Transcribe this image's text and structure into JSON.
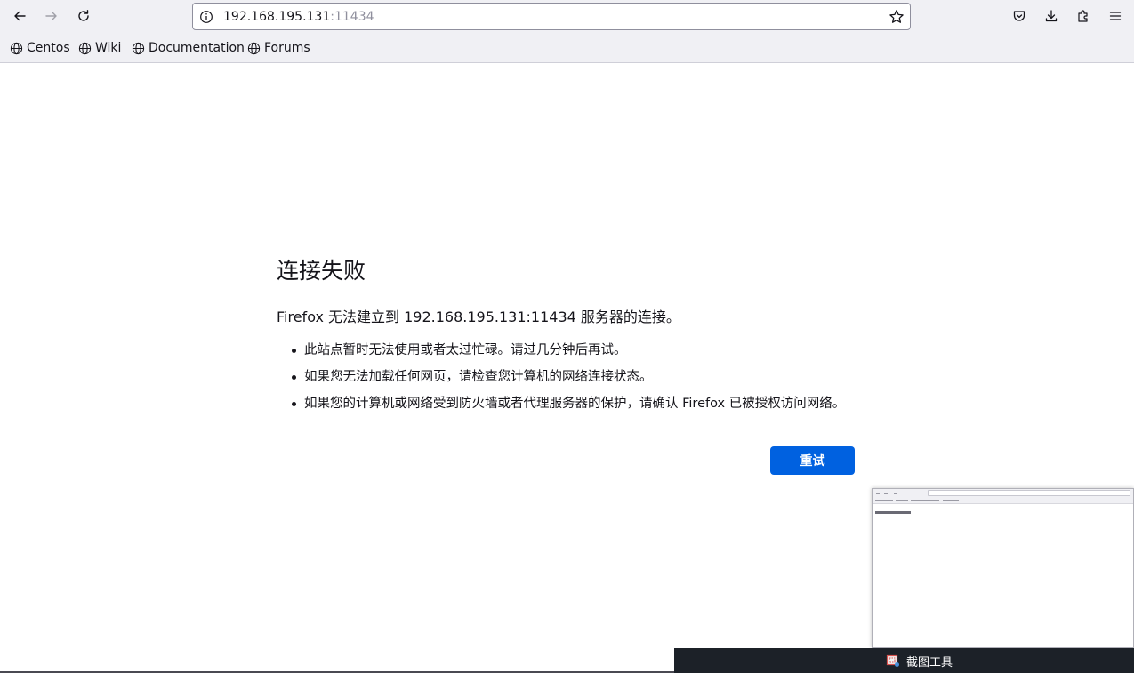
{
  "toolbar": {
    "back_icon": "arrow-left-icon",
    "forward_icon": "arrow-right-icon",
    "reload_icon": "reload-icon",
    "url_host": "192.168.195.131",
    "url_port": ":11434",
    "right_icons": [
      "pocket-icon",
      "download-icon",
      "extensions-icon",
      "menu-icon"
    ]
  },
  "bookmarks": [
    {
      "label": "Centos"
    },
    {
      "label": "Wiki"
    },
    {
      "label": "Documentation"
    },
    {
      "label": "Forums"
    }
  ],
  "error": {
    "title": "连接失败",
    "description": "Firefox 无法建立到 192.168.195.131:11434 服务器的连接。",
    "items": [
      "此站点暂时无法使用或者太过忙碌。请过几分钟后再试。",
      "如果您无法加载任何网页，请检查您计算机的网络连接状态。",
      "如果您的计算机或网络受到防火墙或者代理服务器的保护，请确认 Firefox 已被授权访问网络。"
    ],
    "retry_label": "重试",
    "retry_color": "#0061e0"
  },
  "taskbar": {
    "item_label": "截图工具"
  }
}
